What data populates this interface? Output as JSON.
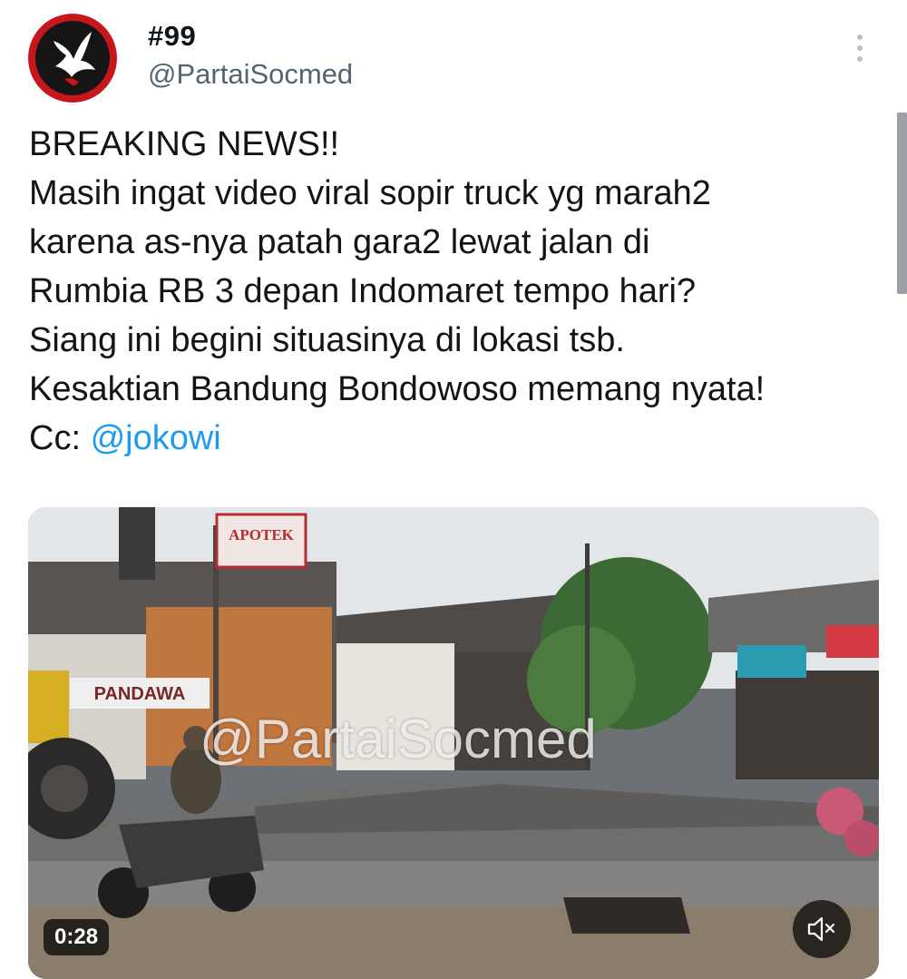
{
  "author": {
    "display_name": "#99",
    "handle": "@PartaiSocmed",
    "avatar_icon": "dove-logo-icon"
  },
  "menu": {
    "icon": "more-vertical-icon"
  },
  "tweet": {
    "line1": "BREAKING NEWS!!",
    "line2": "Masih ingat video viral sopir truck yg marah2",
    "line3": "karena as-nya patah gara2 lewat jalan di",
    "line4": "Rumbia RB 3 depan Indomaret tempo hari?",
    "line5": "Siang ini begini situasinya di lokasi tsb.",
    "line6": "Kesaktian Bandung Bondowoso memang nyata!",
    "cc_label": "Cc: ",
    "mention": "@jokowi"
  },
  "media": {
    "sign_apotek": "APOTEK",
    "sign_pandawa": "PANDAWA",
    "watermark": "@PartaiSocmed",
    "duration": "0:28",
    "mute_icon": "volume-muted-icon"
  },
  "colors": {
    "mention": "#1d9bf0",
    "handle": "#536471",
    "avatar_ring": "#c8161d"
  }
}
